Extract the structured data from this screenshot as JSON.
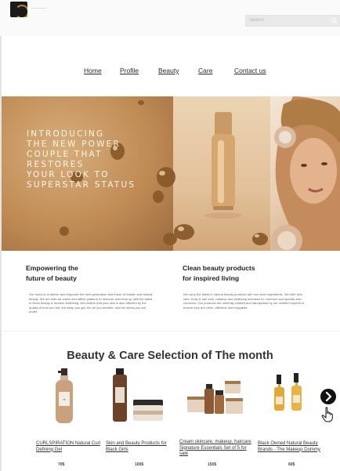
{
  "header": {
    "logo_text": "———",
    "search_placeholder": "Search"
  },
  "nav": {
    "items": [
      {
        "label": "Home"
      },
      {
        "label": "Profile"
      },
      {
        "label": "Beauty"
      },
      {
        "label": "Care"
      },
      {
        "label": "Contact us"
      }
    ]
  },
  "hero": {
    "headline": "INTRODUCING\nTHE NEW POWER\nCOUPLE THAT\nRESTORES\nYOUR LOOK TO\nSUPERSTAR STATUS"
  },
  "columns": [
    {
      "title": "Empowering the\nfuture of beauty",
      "body": "Our focus is to deliver and empower the next generation and future of holistic and natural beauty. We are both an online and offline platform to discover and keep up with the latest in clean beauty & modern wellbeing. We believe that your skin is also affected by the quality of food you eat, the sleep you get, the air you breathe, and the stress you are under."
    },
    {
      "title": "Clean beauty products\nfor inspired living",
      "body": "We carry the latest in natural beauty products with non-toxic ingredients. We offer skin care, body & hair care, makeup and wellbeing solutions for common and specific skin concerns. Our products are carefully curated and handpicked by our certified experts to ensure they are clean, effective and enjoyable."
    }
  ],
  "selection": {
    "title": "Beauty & Care Selection of The month",
    "products": [
      {
        "name": "CURLSPIRATION Natural Curl Defining Gel",
        "price": "70$"
      },
      {
        "name": "Skin and Beauty Products for Black Girls",
        "price": "100$"
      },
      {
        "name": "Cream skincare, makeup, haircare Signature Essentials Set of 5 for sale",
        "price": "150$"
      },
      {
        "name": "Black Owned Natural Beauty Brands - The Makeup Dummy",
        "price": "60$"
      }
    ]
  },
  "icons": {
    "search": "search-icon",
    "next": "chevron-right-icon",
    "cursor": "hand-pointer-icon"
  },
  "colors": {
    "gold": "#c08b55",
    "text": "#2b2b2b",
    "next_button": "#111111"
  }
}
